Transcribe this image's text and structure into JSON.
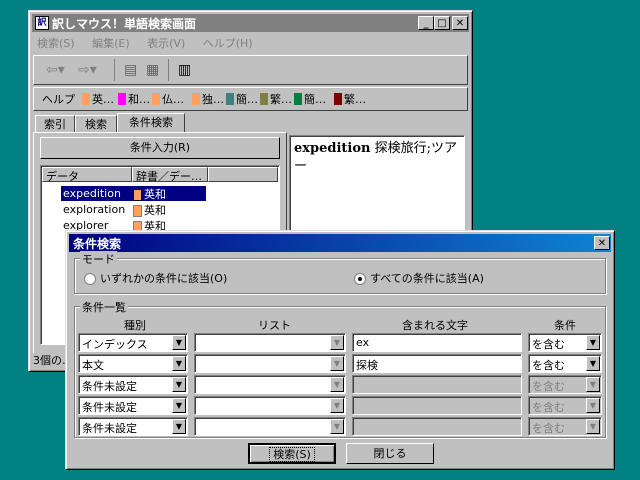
{
  "main_window": {
    "title": "訳しマウス！単語検索画面",
    "menu": [
      "検索(S)",
      "編集(E)",
      "表示(V)",
      "ヘルプ(H)"
    ],
    "lang_buttons": [
      {
        "label": "ヘルプ",
        "color": ""
      },
      {
        "label": "英…",
        "color": "#ffa060"
      },
      {
        "label": "和…",
        "color": "#ff00ff"
      },
      {
        "label": "仏…",
        "color": "#ffa060"
      },
      {
        "label": "独…",
        "color": "#ffa060"
      },
      {
        "label": "簡…",
        "color": "#408080"
      },
      {
        "label": "繁…",
        "color": "#808040"
      },
      {
        "label": "簡…",
        "color": "#008040"
      },
      {
        "label": "繁…",
        "color": "#800000"
      }
    ],
    "tabs": [
      "索引",
      "検索",
      "条件検索"
    ],
    "condition_input_button": "条件入力(R)",
    "list_headers": [
      "データ",
      "辞書／デー…"
    ],
    "results": [
      {
        "word": "expedition",
        "dict": "英和",
        "selected": true
      },
      {
        "word": "exploration",
        "dict": "英和",
        "selected": false
      },
      {
        "word": "explorer",
        "dict": "英和",
        "selected": false
      }
    ],
    "definition_word": "expedition",
    "definition_text": " 探検旅行;ツアー",
    "status_text": "3個の…"
  },
  "dialog": {
    "title": "条件検索",
    "mode_label": "モード",
    "mode_any": "いずれかの条件に該当(O)",
    "mode_all": "すべての条件に該当(A)",
    "list_label": "条件一覧",
    "columns": [
      "種別",
      "リスト",
      "含まれる文字",
      "条件"
    ],
    "rows": [
      {
        "type": "インデックス",
        "list": "",
        "text": "ex",
        "cond": "を含む",
        "enabled": true
      },
      {
        "type": "本文",
        "list": "",
        "text": "探検",
        "cond": "を含む",
        "enabled": true
      },
      {
        "type": "条件未設定",
        "list": "",
        "text": "",
        "cond": "を含む",
        "enabled": false
      },
      {
        "type": "条件未設定",
        "list": "",
        "text": "",
        "cond": "を含む",
        "enabled": false
      },
      {
        "type": "条件未設定",
        "list": "",
        "text": "",
        "cond": "を含む",
        "enabled": false
      }
    ],
    "search_button": "検索(S)",
    "close_button": "閉じる"
  }
}
